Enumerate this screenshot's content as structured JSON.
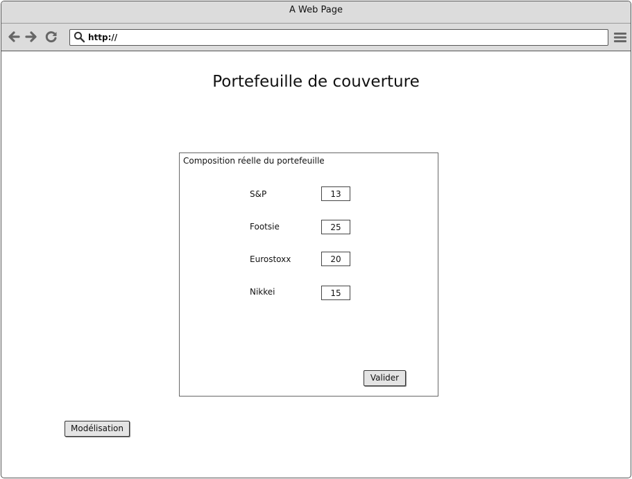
{
  "window": {
    "title": "A Web Page"
  },
  "toolbar": {
    "url": "http://",
    "icons": [
      "back-arrow-icon",
      "forward-arrow-icon",
      "reload-icon",
      "search-icon",
      "menu-icon"
    ]
  },
  "page": {
    "title": "Portefeuille de couverture"
  },
  "panel": {
    "title": "Composition réelle du portefeuille",
    "rows": [
      {
        "label": "S&P",
        "value": "13"
      },
      {
        "label": "Footsie",
        "value": "25"
      },
      {
        "label": "Eurostoxx",
        "value": "20"
      },
      {
        "label": "Nikkei",
        "value": "15"
      }
    ],
    "submit_label": "Valider"
  },
  "footer": {
    "model_button_label": "Modélisation"
  }
}
